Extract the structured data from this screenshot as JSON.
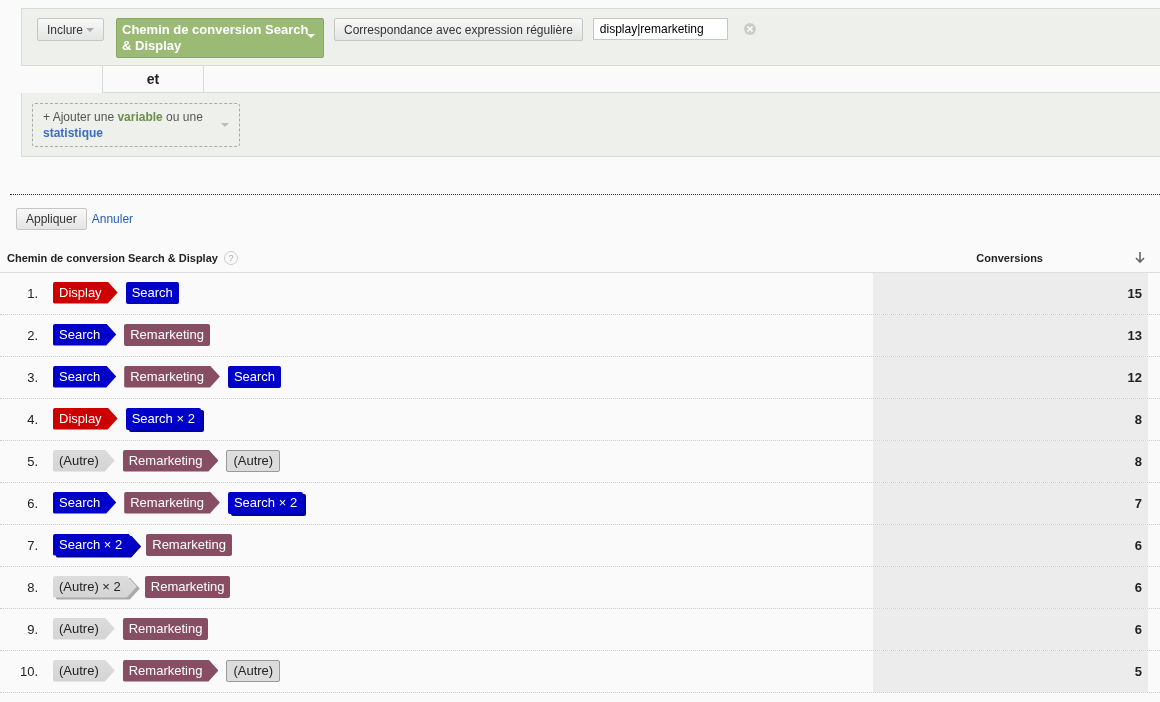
{
  "filter": {
    "mode": "Inclure",
    "dimension": "Chemin de conversion Search & Display",
    "match_type": "Correspondance avec expression régulière",
    "value": "display|remarketing"
  },
  "connector": "et",
  "add_condition": {
    "text": "+ Ajouter une **variable** ou une",
    "link": "statistique"
  },
  "actions": {
    "apply": "Appliquer",
    "cancel": "Annuler"
  },
  "table": {
    "help": "?",
    "columns": [
      "Chemin de conversion Search & Display",
      "Conversions"
    ],
    "rows": [
      {
        "rank": "1.",
        "steps": [
          {
            "kind": "display",
            "label": "Display",
            "stacked": false
          },
          {
            "kind": "search",
            "label": "Search",
            "stacked": false
          }
        ],
        "conversions": "15"
      },
      {
        "rank": "2.",
        "steps": [
          {
            "kind": "search",
            "label": "Search",
            "stacked": false
          },
          {
            "kind": "remarketing",
            "label": "Remarketing",
            "stacked": false
          }
        ],
        "conversions": "13"
      },
      {
        "rank": "3.",
        "steps": [
          {
            "kind": "search",
            "label": "Search",
            "stacked": false
          },
          {
            "kind": "remarketing",
            "label": "Remarketing",
            "stacked": false
          },
          {
            "kind": "search",
            "label": "Search",
            "stacked": false
          }
        ],
        "conversions": "12"
      },
      {
        "rank": "4.",
        "steps": [
          {
            "kind": "display",
            "label": "Display",
            "stacked": false
          },
          {
            "kind": "search",
            "label": "Search × 2",
            "stacked": true
          }
        ],
        "conversions": "8"
      },
      {
        "rank": "5.",
        "steps": [
          {
            "kind": "other",
            "label": "(Autre)",
            "stacked": false
          },
          {
            "kind": "remarketing",
            "label": "Remarketing",
            "stacked": false
          },
          {
            "kind": "other",
            "label": "(Autre)",
            "stacked": false
          }
        ],
        "conversions": "8"
      },
      {
        "rank": "6.",
        "steps": [
          {
            "kind": "search",
            "label": "Search",
            "stacked": false
          },
          {
            "kind": "remarketing",
            "label": "Remarketing",
            "stacked": false
          },
          {
            "kind": "search",
            "label": "Search × 2",
            "stacked": true
          }
        ],
        "conversions": "7"
      },
      {
        "rank": "7.",
        "steps": [
          {
            "kind": "search",
            "label": "Search × 2",
            "stacked": true
          },
          {
            "kind": "remarketing",
            "label": "Remarketing",
            "stacked": false
          }
        ],
        "conversions": "6"
      },
      {
        "rank": "8.",
        "steps": [
          {
            "kind": "other",
            "label": "(Autre) × 2",
            "stacked": true
          },
          {
            "kind": "remarketing",
            "label": "Remarketing",
            "stacked": false
          }
        ],
        "conversions": "6"
      },
      {
        "rank": "9.",
        "steps": [
          {
            "kind": "other",
            "label": "(Autre)",
            "stacked": false
          },
          {
            "kind": "remarketing",
            "label": "Remarketing",
            "stacked": false
          }
        ],
        "conversions": "6"
      },
      {
        "rank": "10.",
        "steps": [
          {
            "kind": "other",
            "label": "(Autre)",
            "stacked": false
          },
          {
            "kind": "remarketing",
            "label": "Remarketing",
            "stacked": false
          },
          {
            "kind": "other",
            "label": "(Autre)",
            "stacked": false
          }
        ],
        "conversions": "5"
      }
    ]
  }
}
